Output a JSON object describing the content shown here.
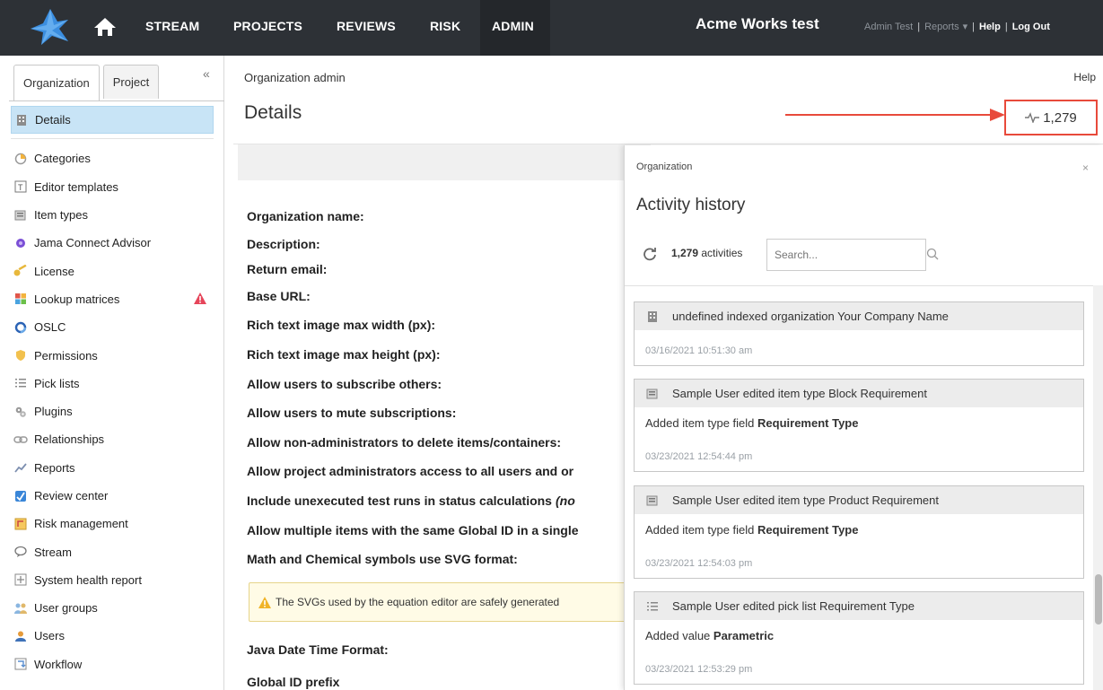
{
  "topnav": {
    "items": [
      "STREAM",
      "PROJECTS",
      "REVIEWS",
      "RISK",
      "ADMIN"
    ],
    "app_title": "Acme Works test",
    "user": "Admin Test",
    "reports": "Reports",
    "help": "Help",
    "logout": "Log Out",
    "separator": "|"
  },
  "sidebar": {
    "tabs": [
      "Organization",
      "Project"
    ],
    "collapse_glyph": "«",
    "selected": "Details",
    "items": [
      {
        "label": "Details",
        "icon": "building-icon"
      },
      {
        "label": "Categories",
        "icon": "categories-icon"
      },
      {
        "label": "Editor templates",
        "icon": "template-icon"
      },
      {
        "label": "Item types",
        "icon": "item-types-icon"
      },
      {
        "label": "Jama Connect Advisor",
        "icon": "advisor-icon"
      },
      {
        "label": "License",
        "icon": "key-icon"
      },
      {
        "label": "Lookup matrices",
        "icon": "matrix-icon",
        "warning": true
      },
      {
        "label": "OSLC",
        "icon": "oslc-icon"
      },
      {
        "label": "Permissions",
        "icon": "shield-icon"
      },
      {
        "label": "Pick lists",
        "icon": "list-icon"
      },
      {
        "label": "Plugins",
        "icon": "plugin-icon"
      },
      {
        "label": "Relationships",
        "icon": "link-icon"
      },
      {
        "label": "Reports",
        "icon": "chart-icon"
      },
      {
        "label": "Review center",
        "icon": "review-icon"
      },
      {
        "label": "Risk management",
        "icon": "risk-icon"
      },
      {
        "label": "Stream",
        "icon": "stream-icon"
      },
      {
        "label": "System health report",
        "icon": "health-icon"
      },
      {
        "label": "User groups",
        "icon": "group-icon"
      },
      {
        "label": "Users",
        "icon": "user-icon"
      },
      {
        "label": "Workflow",
        "icon": "workflow-icon"
      }
    ]
  },
  "main": {
    "breadcrumb": "Organization admin",
    "help": "Help",
    "title": "Details",
    "activity_count": "1,279",
    "fields": [
      "Organization name:",
      "Description:",
      "Return email:",
      "Base URL:",
      "Rich text image max width (px):",
      "Rich text image max height (px):",
      "Allow users to subscribe others:",
      "Allow users to mute subscriptions:",
      "Allow non-administrators to delete items/containers:",
      "Allow project administrators access to all users and or",
      "Include unexecuted test runs in status calculations ",
      "Allow multiple items with the same Global ID in a single",
      "Math and Chemical symbols use SVG format:"
    ],
    "include_italic": "(no",
    "info_text": "The SVGs used by the equation editor are safely generated",
    "fields_after": [
      "Java Date Time Format:",
      "Global ID prefix"
    ]
  },
  "activity": {
    "context": "Organization",
    "close": "×",
    "title": "Activity history",
    "count": "1,279",
    "count_suffix": "activities",
    "search_placeholder": "Search...",
    "entries": [
      {
        "icon": "building-icon",
        "head": "undefined indexed organization Your Company Name",
        "body_prefix": "",
        "body_bold": "",
        "time": "03/16/2021 10:51:30 am"
      },
      {
        "icon": "item-types-icon",
        "head": "Sample User edited item type Block Requirement",
        "body_prefix": "Added item type field ",
        "body_bold": "Requirement Type",
        "time": "03/23/2021 12:54:44 pm"
      },
      {
        "icon": "item-types-icon",
        "head": "Sample User edited item type Product Requirement",
        "body_prefix": "Added item type field ",
        "body_bold": "Requirement Type",
        "time": "03/23/2021 12:54:03 pm"
      },
      {
        "icon": "list-icon",
        "head": "Sample User edited pick list Requirement Type",
        "body_prefix": "Added value ",
        "body_bold": "Parametric",
        "time": "03/23/2021 12:53:29 pm"
      }
    ]
  },
  "colors": {
    "topbar": "#2d3136",
    "selected_row": "#c8e4f6",
    "highlight_box": "#e84a3b",
    "warning": "#f0a020"
  }
}
